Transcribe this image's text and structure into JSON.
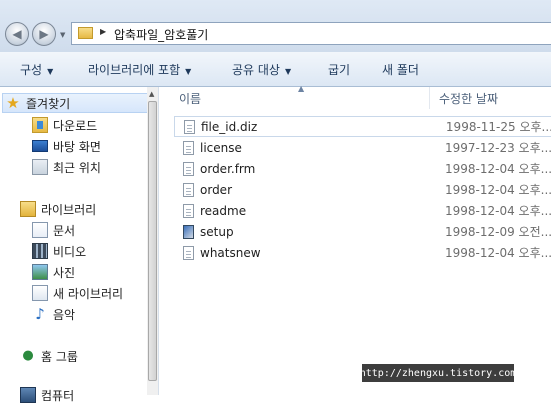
{
  "address_bar": {
    "path": "압축파일_암호풀기"
  },
  "toolbar": {
    "organize": "구성",
    "include_in_library": "라이브러리에 포함",
    "share_with": "공유 대상",
    "burn": "굽기",
    "new_folder": "새 폴더"
  },
  "nav": {
    "favorites": "즐겨찾기",
    "downloads": "다운로드",
    "desktop": "바탕 화면",
    "recent": "최근 위치",
    "libraries": "라이브러리",
    "documents": "문서",
    "videos": "비디오",
    "pictures": "사진",
    "new_library": "새 라이브러리",
    "music": "음악",
    "homegroup": "홈 그룹",
    "computer": "컴퓨터"
  },
  "columns": {
    "name": "이름",
    "date_modified": "수정한 날짜"
  },
  "files": [
    {
      "name": "file_id.diz",
      "date": "1998-11-25 오후...",
      "icon": "text-file-icon"
    },
    {
      "name": "license",
      "date": "1997-12-23 오후...",
      "icon": "text-file-icon"
    },
    {
      "name": "order.frm",
      "date": "1998-12-04 오후...",
      "icon": "text-file-icon"
    },
    {
      "name": "order",
      "date": "1998-12-04 오후...",
      "icon": "text-file-icon"
    },
    {
      "name": "readme",
      "date": "1998-12-04 오후...",
      "icon": "text-file-icon"
    },
    {
      "name": "setup",
      "date": "1998-12-09 오전...",
      "icon": "setup-icon"
    },
    {
      "name": "whatsnew",
      "date": "1998-12-04 오후...",
      "icon": "text-file-icon"
    }
  ],
  "watermark": "http://zhengxu.tistory.com"
}
